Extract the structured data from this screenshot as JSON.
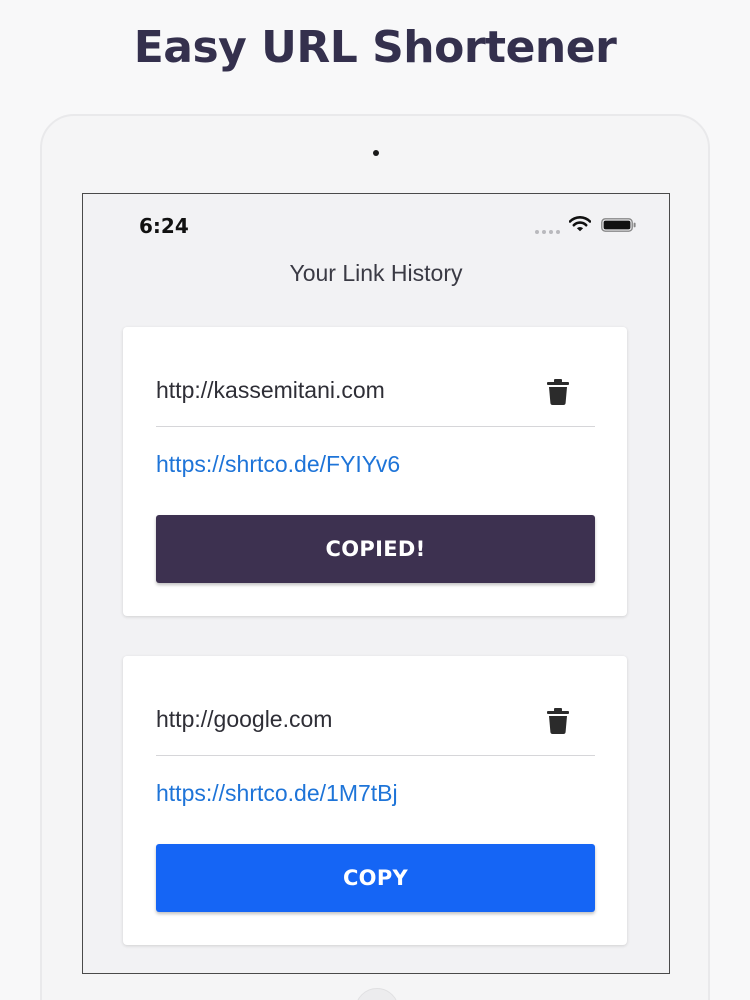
{
  "promo": {
    "title": "Easy URL Shortener"
  },
  "status_bar": {
    "time": "6:24",
    "icons": [
      "signal-dots-icon",
      "wifi-icon",
      "battery-icon"
    ]
  },
  "screen": {
    "title": "Your Link History"
  },
  "links": [
    {
      "original": "http://kassemitani.com",
      "short": "https://shrtco.de/FYIYv6",
      "button_label": "COPIED!",
      "button_color": "#3d3150",
      "state": "copied"
    },
    {
      "original": "http://google.com",
      "short": "https://shrtco.de/1M7tBj",
      "button_label": "COPY",
      "button_color": "#1565f5",
      "state": "idle"
    }
  ],
  "colors": {
    "heading": "#34304d",
    "link": "#1e74d8",
    "copied_button": "#3d3150",
    "copy_button": "#1565f5"
  }
}
